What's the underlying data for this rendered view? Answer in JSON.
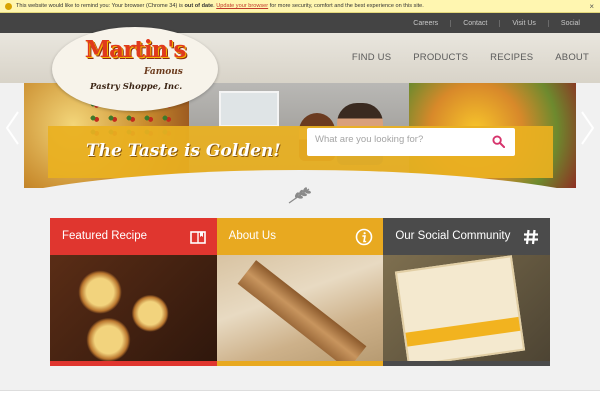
{
  "browser_notice": {
    "prefix": "This website would like to remind you: Your browser (Chrome 34) is ",
    "emphasis": "out of date",
    "middle": ". ",
    "link": "Update your browser",
    "suffix": " for more security, comfort and the best experience on this site.",
    "close": "×"
  },
  "utility_nav": [
    "Careers",
    "Contact",
    "Visit Us",
    "Social"
  ],
  "logo": {
    "brand": "Martin's",
    "famous": "Famous",
    "shoppe": "Pastry Shoppe, Inc."
  },
  "main_nav": [
    "FIND US",
    "PRODUCTS",
    "RECIPES",
    "ABOUT"
  ],
  "hero": {
    "tagline": "The Taste is Golden!",
    "search_placeholder": "What are you looking for?"
  },
  "cards": [
    {
      "label": "Featured Recipe",
      "icon": "recipe-book-icon",
      "color": "#e0362f"
    },
    {
      "label": "About Us",
      "icon": "info-icon",
      "color": "#e8a920"
    },
    {
      "label": "Our Social Community",
      "icon": "hashtag-icon",
      "color": "#4b4b4b"
    }
  ],
  "colors": {
    "accent_red": "#e0362f",
    "accent_gold": "#e8a920",
    "dark_gray": "#4b4b4b",
    "util_nav_bg": "#444444"
  }
}
